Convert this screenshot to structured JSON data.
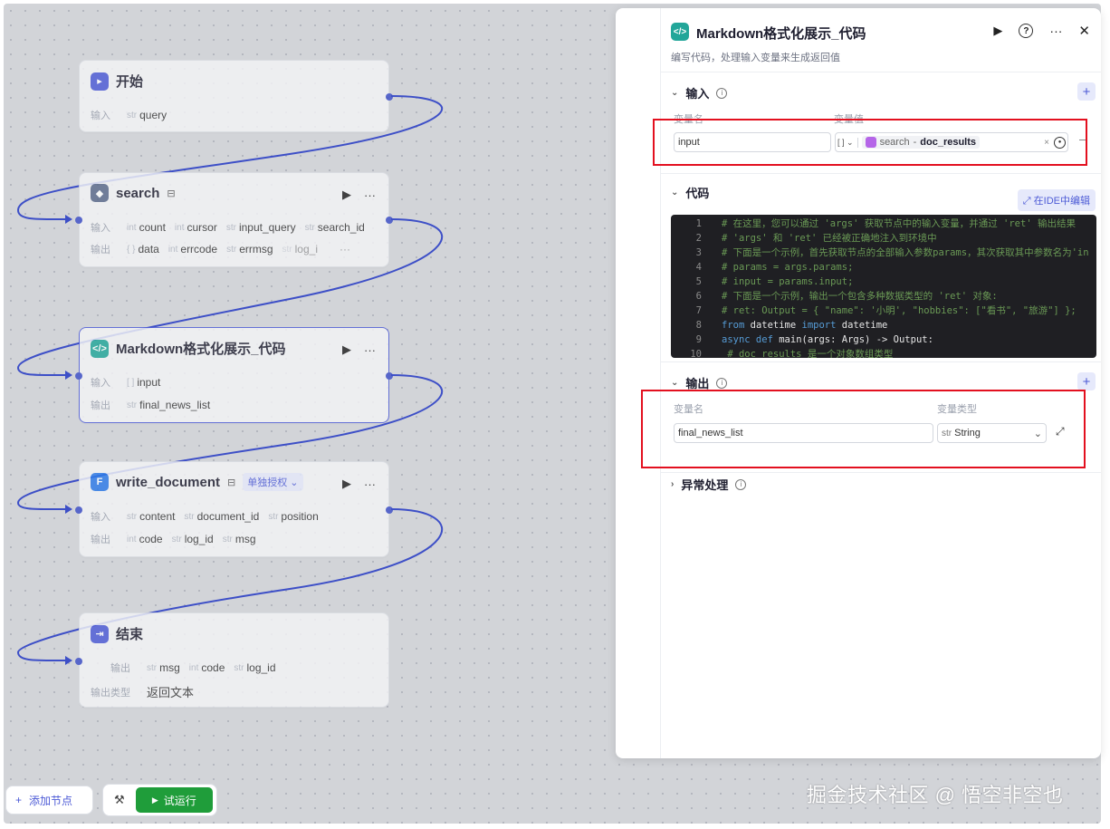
{
  "nodes": {
    "start": {
      "title": "开始",
      "input_label": "输入",
      "vars": [
        {
          "type": "str",
          "name": "query"
        }
      ]
    },
    "search": {
      "title": "search",
      "input_label": "输入",
      "output_label": "输出",
      "inputs": [
        {
          "type": "int",
          "name": "count"
        },
        {
          "type": "int",
          "name": "cursor"
        },
        {
          "type": "str",
          "name": "input_query"
        },
        {
          "type": "str",
          "name": "search_id"
        }
      ],
      "outputs": [
        {
          "type": "{ }",
          "name": "data"
        },
        {
          "type": "int",
          "name": "errcode"
        },
        {
          "type": "str",
          "name": "errmsg"
        },
        {
          "type": "str",
          "name": "log_i"
        }
      ],
      "more": "···"
    },
    "markdown": {
      "title": "Markdown格式化展示_代码",
      "input_label": "输入",
      "output_label": "输出",
      "inputs": [
        {
          "type": "[ ]",
          "name": "input"
        }
      ],
      "outputs": [
        {
          "type": "str",
          "name": "final_news_list"
        }
      ]
    },
    "write": {
      "title": "write_document",
      "auth_badge": "单独授权",
      "input_label": "输入",
      "output_label": "输出",
      "inputs": [
        {
          "type": "str",
          "name": "content"
        },
        {
          "type": "str",
          "name": "document_id"
        },
        {
          "type": "str",
          "name": "position"
        }
      ],
      "outputs": [
        {
          "type": "int",
          "name": "code"
        },
        {
          "type": "str",
          "name": "log_id"
        },
        {
          "type": "str",
          "name": "msg"
        }
      ]
    },
    "end": {
      "title": "结束",
      "output_label": "输出",
      "outputs": [
        {
          "type": "str",
          "name": "msg"
        },
        {
          "type": "int",
          "name": "code"
        },
        {
          "type": "str",
          "name": "log_id"
        }
      ],
      "output_type_label": "输出类型",
      "output_type_value": "返回文本"
    }
  },
  "bottom": {
    "add_node": "添加节点",
    "test_run": "试运行"
  },
  "panel": {
    "title": "Markdown格式化展示_代码",
    "description": "编写代码，处理输入变量来生成返回值",
    "input_section": {
      "title": "输入",
      "col_name": "变量名",
      "col_value": "变量值",
      "var_name": "input",
      "value_type_icon": "[ ]",
      "ref_node": "search",
      "ref_sep": "-",
      "ref_field": "doc_results"
    },
    "code_section": {
      "title": "代码",
      "ide_button": "在IDE中编辑",
      "lines": [
        {
          "n": "1",
          "parts": [
            {
              "c": "comment",
              "t": "# 在这里，您可以通过 'args'  获取节点中的输入变量，并通过 'ret' 输出结果"
            }
          ]
        },
        {
          "n": "2",
          "parts": [
            {
              "c": "comment",
              "t": "# 'args' 和 'ret' 已经被正确地注入到环境中"
            }
          ]
        },
        {
          "n": "3",
          "parts": [
            {
              "c": "comment",
              "t": "# 下面是一个示例，首先获取节点的全部输入参数params，其次获取其中参数名为'in"
            }
          ]
        },
        {
          "n": "4",
          "parts": [
            {
              "c": "comment",
              "t": "# params = args.params;"
            }
          ]
        },
        {
          "n": "5",
          "parts": [
            {
              "c": "comment",
              "t": "# input = params.input;"
            }
          ]
        },
        {
          "n": "6",
          "parts": [
            {
              "c": "comment",
              "t": "# 下面是一个示例，输出一个包含多种数据类型的 'ret' 对象:"
            }
          ]
        },
        {
          "n": "7",
          "parts": [
            {
              "c": "comment",
              "t": "# ret: Output =  { \"name\": '小明', \"hobbies\": [\"看书\", \"旅游\"] };"
            }
          ]
        },
        {
          "n": "8",
          "parts": [
            {
              "c": "kw",
              "t": "from"
            },
            {
              "c": "text",
              "t": " datetime "
            },
            {
              "c": "kw",
              "t": "import"
            },
            {
              "c": "text",
              "t": " datetime"
            }
          ]
        },
        {
          "n": "9",
          "parts": [
            {
              "c": "kw",
              "t": "async def"
            },
            {
              "c": "text",
              "t": " main(args: Args) -> Output:"
            }
          ]
        },
        {
          "n": "10",
          "parts": [
            {
              "c": "comment",
              "t": "    # doc_results 是一个对象数组类型"
            }
          ]
        }
      ]
    },
    "output_section": {
      "title": "输出",
      "col_name": "变量名",
      "col_type": "变量类型",
      "var_name": "final_news_list",
      "type_prefix": "str",
      "type_value": "String"
    },
    "error_section": {
      "title": "异常处理"
    }
  },
  "watermark": "掘金技术社区 @ 悟空非空也",
  "colors": {
    "accent": "#4d5bd6",
    "highlight_box": "#e3101f",
    "run_button": "#1f9d3a",
    "code_icon": "#22a699"
  }
}
